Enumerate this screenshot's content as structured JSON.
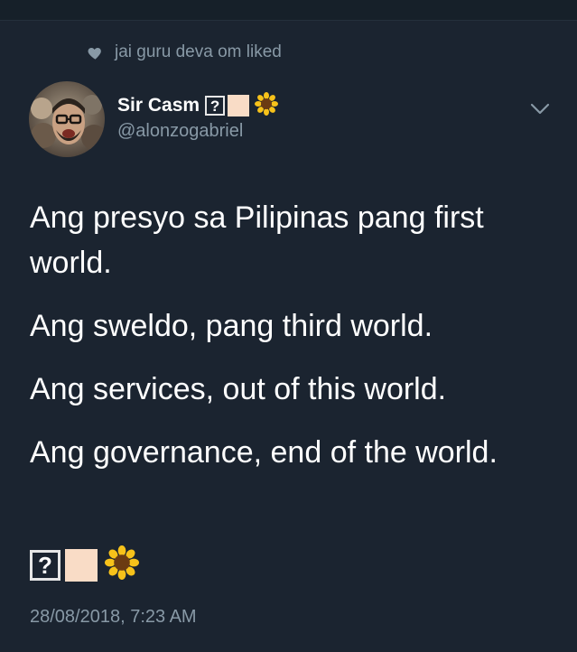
{
  "context": {
    "icon": "heart-icon",
    "text": "jai guru deva om liked"
  },
  "author": {
    "display_name": "Sir Casm",
    "handle": "@alonzogabriel",
    "badges": [
      "?",
      "skin-tone-swatch",
      "sunflower-icon"
    ]
  },
  "menu": {
    "icon": "chevron-down-icon"
  },
  "tweet": {
    "paragraphs": [
      "Ang presyo sa Pilipinas pang first world.",
      "Ang sweldo, pang third world.",
      "Ang services, out of this world.",
      "Ang governance, end of the world."
    ],
    "emoji_row": {
      "q": "?",
      "icons": [
        "skin-tone-swatch",
        "sunflower-icon"
      ]
    },
    "timestamp": "28/08/2018, 7:23 AM"
  },
  "colors": {
    "background": "#1b2430",
    "text": "#ffffff",
    "muted": "#8899a6",
    "skin": "#f9dcc6"
  }
}
